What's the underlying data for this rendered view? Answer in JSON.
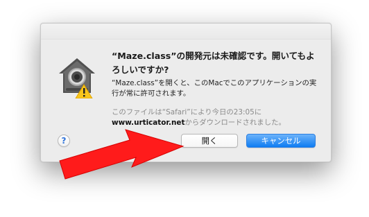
{
  "dialog": {
    "title": "“Maze.class”の開発元は未確認です。開いてもよろしいですか?",
    "description": "“Maze.class”を開くと、このMacでこのアプリケーションの実行が常に許可されます。",
    "source_prefix": "このファイルは“Safari”により今日の23:05に",
    "source_domain": "www.urticator.net",
    "source_suffix": "からダウンロードされました。"
  },
  "buttons": {
    "help_label": "?",
    "open_label": "開く",
    "cancel_label": "キャンセル"
  },
  "icons": {
    "app": "locked-house-warning-icon",
    "annotation": "red-arrow-annotation"
  },
  "colors": {
    "accent": "#0f7cf2",
    "arrow": "#ff1b1b"
  }
}
